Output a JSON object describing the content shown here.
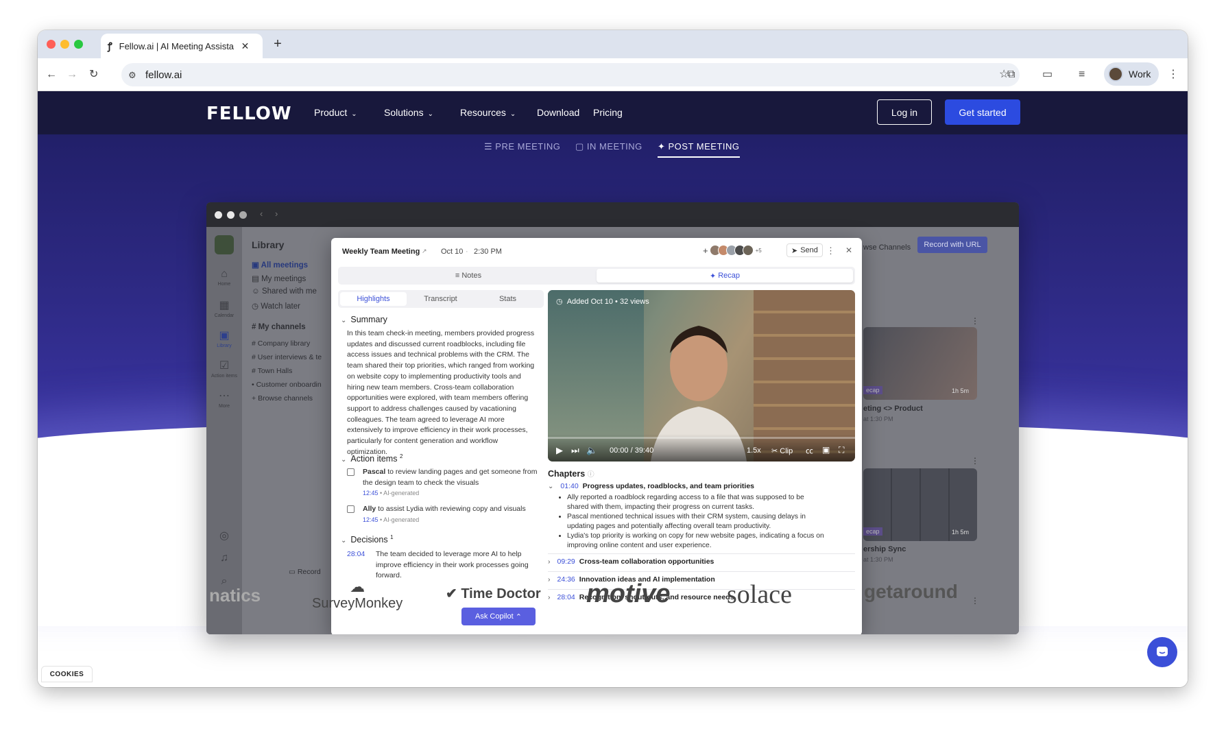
{
  "browser": {
    "tab_title": "Fellow.ai | AI Meeting Assista",
    "new_tab_label": "+",
    "url": "fellow.ai",
    "profile_label": "Work"
  },
  "nav": {
    "logo": "FELLOW",
    "links": [
      "Product",
      "Solutions",
      "Resources",
      "Download",
      "Pricing"
    ],
    "login": "Log in",
    "get_started": "Get started"
  },
  "phases": [
    "PRE MEETING",
    "IN MEETING",
    "POST MEETING"
  ],
  "app_bg": {
    "library_title": "Library",
    "items": [
      "All meetings",
      "My meetings",
      "Shared with me",
      "Watch later"
    ],
    "channels_title": "My channels",
    "channels": [
      "Company library",
      "User interviews & te",
      "Town Halls",
      "Customer onboardin",
      "Browse channels"
    ],
    "rail": [
      "Home",
      "Calendar",
      "Library",
      "Action items",
      "More"
    ],
    "record": "Record",
    "browse_channels": "wse Channels",
    "record_url": "Record with URL",
    "cards": [
      {
        "title": "eting <> Product",
        "sub": "at 1:30 PM",
        "duration": "1h 5m",
        "tag": "ecap"
      },
      {
        "title": "ership Sync",
        "sub": "at 1:30 PM",
        "duration": "1h 5m",
        "tag": "ecap"
      }
    ]
  },
  "modal": {
    "title": "Weekly Team Meeting",
    "date": "Oct 10",
    "time": "2:30 PM",
    "more_count": "+5",
    "send": "Send",
    "tabs": [
      "Notes",
      "Recap"
    ],
    "subtabs": [
      "Highlights",
      "Transcript",
      "Stats"
    ],
    "summary_title": "Summary",
    "summary": "In this team check-in meeting, members provided progress updates and discussed current roadblocks, including file access issues and technical problems with the CRM. The team shared their top priorities, which ranged from working on website copy to implementing productivity tools and hiring new team members. Cross-team collaboration opportunities were explored, with team members offering support to address challenges caused by vacationing colleagues. The team agreed to leverage AI more extensively to improve efficiency in their work processes, particularly for content generation and workflow optimization.",
    "action_items_title": "Action items",
    "action_items_count": "2",
    "action_items": [
      {
        "name": "Pascal",
        "text": " to review landing pages and get someone from the design team to check the visuals",
        "ts": "12:45",
        "tag": " • AI-generated"
      },
      {
        "name": "Ally",
        "text": " to assist Lydia with reviewing copy and visuals",
        "ts": "12:45",
        "tag": " • AI-generated"
      }
    ],
    "decisions_title": "Decisions",
    "decisions_count": "1",
    "decision": {
      "ts": "28:04",
      "text": "The team decided to leverage more AI to help improve efficiency in their work processes going forward."
    },
    "ask_copilot": "Ask Copilot",
    "video": {
      "label": "Added Oct 10 • 32 views",
      "time": "00:00 / 39:40",
      "speed": "1.5x",
      "clip": "Clip",
      "progress": 0
    },
    "chapters_title": "Chapters",
    "chapters": [
      {
        "ts": "01:40",
        "title": "Progress updates, roadblocks, and team priorities",
        "bullets": [
          "Ally reported a roadblock regarding access to a file that was supposed to be shared with them, impacting their progress on current tasks.",
          "Pascal mentioned technical issues with their CRM system, causing delays in updating pages and potentially affecting overall team productivity.",
          "Lydia's top priority is working on copy for new website pages, indicating a focus on improving online content and user experience."
        ]
      },
      {
        "ts": "09:29",
        "title": "Cross-team collaboration opportunities"
      },
      {
        "ts": "24:36",
        "title": "Innovation ideas and AI implementation"
      },
      {
        "ts": "28:04",
        "title": "Recognition, shout-outs, and resource needs"
      }
    ]
  },
  "logos": [
    "natics",
    "SurveyMonkey",
    "Time Doctor",
    "motive",
    "solace",
    "getaround"
  ],
  "cookies": "COOKIES",
  "colors": {
    "accent": "#2c4be0",
    "nav_bg": "#18183c",
    "hero": "#2e2a85"
  }
}
